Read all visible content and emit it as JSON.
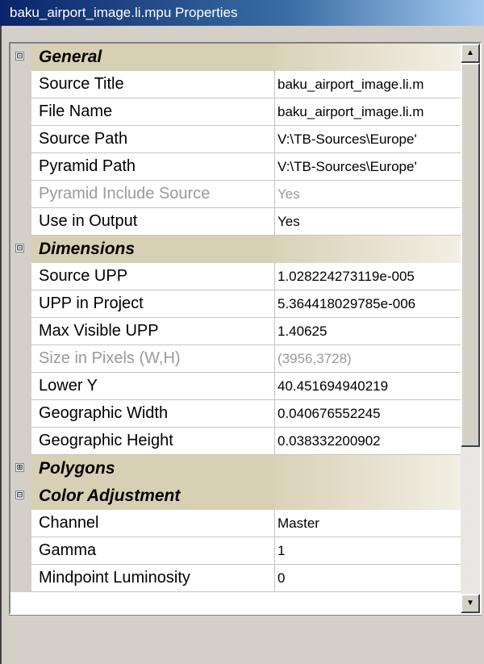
{
  "window": {
    "title": "baku_airport_image.li.mpu Properties"
  },
  "grid": {
    "rows": [
      {
        "type": "category",
        "label": "General",
        "toggle": "⊟"
      },
      {
        "type": "property",
        "name": "Source Title",
        "value": "baku_airport_image.li.m",
        "disabled": false
      },
      {
        "type": "property",
        "name": "File Name",
        "value": "baku_airport_image.li.m",
        "disabled": false
      },
      {
        "type": "property",
        "name": "Source Path",
        "value": "V:\\TB-Sources\\Europe'",
        "disabled": false
      },
      {
        "type": "property",
        "name": "Pyramid Path",
        "value": "V:\\TB-Sources\\Europe'",
        "disabled": false
      },
      {
        "type": "property",
        "name": "Pyramid Include Source",
        "value": "Yes",
        "disabled": true
      },
      {
        "type": "property",
        "name": "Use in Output",
        "value": "Yes",
        "disabled": false
      },
      {
        "type": "category",
        "label": "Dimensions",
        "toggle": "⊟"
      },
      {
        "type": "property",
        "name": "Source UPP",
        "value": "1.028224273119e-005",
        "disabled": false
      },
      {
        "type": "property",
        "name": "UPP in Project",
        "value": "5.364418029785e-006",
        "disabled": false
      },
      {
        "type": "property",
        "name": "Max Visible UPP",
        "value": "1.40625",
        "disabled": false
      },
      {
        "type": "property",
        "name": "Size in Pixels (W,H)",
        "value": "(3956,3728)",
        "disabled": true
      },
      {
        "type": "property",
        "name": "Lower Y",
        "value": "40.451694940219",
        "disabled": false
      },
      {
        "type": "property",
        "name": "Geographic Width",
        "value": "0.040676552245",
        "disabled": false
      },
      {
        "type": "property",
        "name": "Geographic Height",
        "value": "0.038332200902",
        "disabled": false
      },
      {
        "type": "category",
        "label": "Polygons",
        "toggle": "⊞"
      },
      {
        "type": "category",
        "label": "Color Adjustment",
        "toggle": "⊟"
      },
      {
        "type": "property",
        "name": "Channel",
        "value": "Master",
        "disabled": false
      },
      {
        "type": "property",
        "name": "Gamma",
        "value": "1",
        "disabled": false
      },
      {
        "type": "property",
        "name": "Mindpoint Luminosity",
        "value": "0",
        "disabled": false
      }
    ]
  },
  "scrollbar": {
    "up_arrow": "▲",
    "down_arrow": "▼"
  }
}
